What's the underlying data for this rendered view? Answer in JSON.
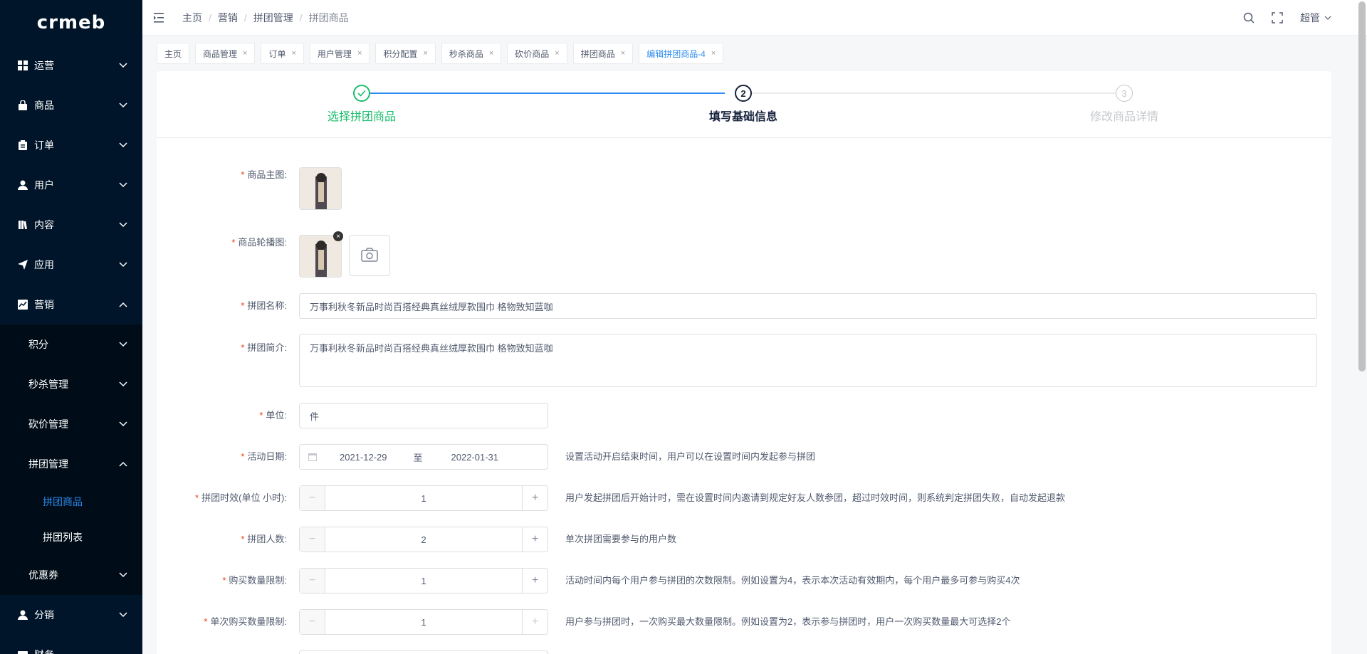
{
  "app": {
    "logo": "crmeb"
  },
  "sidebar": {
    "items": [
      {
        "label": "运营",
        "icon": "grid-icon"
      },
      {
        "label": "商品",
        "icon": "bag-icon"
      },
      {
        "label": "订单",
        "icon": "clipboard-icon"
      },
      {
        "label": "用户",
        "icon": "user-icon"
      },
      {
        "label": "内容",
        "icon": "book-icon"
      },
      {
        "label": "应用",
        "icon": "send-icon"
      },
      {
        "label": "营销",
        "icon": "chart-icon"
      }
    ],
    "marketing_sub": [
      {
        "label": "积分"
      },
      {
        "label": "秒杀管理"
      },
      {
        "label": "砍价管理"
      },
      {
        "label": "拼团管理"
      }
    ],
    "group_sub": [
      {
        "label": "拼团商品"
      },
      {
        "label": "拼团列表"
      }
    ],
    "coupon": "优惠券",
    "distribution": "分销",
    "finance": "财务"
  },
  "header": {
    "breadcrumb": [
      "主页",
      "营销",
      "拼团管理",
      "拼团商品"
    ],
    "user": "超管"
  },
  "tags": [
    {
      "label": "主页",
      "closable": false
    },
    {
      "label": "商品管理",
      "closable": true
    },
    {
      "label": "订单",
      "closable": true
    },
    {
      "label": "用户管理",
      "closable": true
    },
    {
      "label": "积分配置",
      "closable": true
    },
    {
      "label": "秒杀商品",
      "closable": true
    },
    {
      "label": "砍价商品",
      "closable": true
    },
    {
      "label": "拼团商品",
      "closable": true
    },
    {
      "label": "编辑拼团商品-4",
      "closable": true
    }
  ],
  "steps": [
    {
      "title": "选择拼团商品",
      "number": "",
      "status": "done"
    },
    {
      "title": "填写基础信息",
      "number": "2",
      "status": "current"
    },
    {
      "title": "修改商品详情",
      "number": "3",
      "status": "wait"
    }
  ],
  "form": {
    "main_image_label": "商品主图:",
    "carousel_label": "商品轮播图:",
    "name_label": "拼团名称:",
    "name_value": "万事利秋冬新品时尚百搭经典真丝绒厚款围巾 格物致知蓝咖",
    "intro_label": "拼团简介:",
    "intro_value": "万事利秋冬新品时尚百搭经典真丝绒厚款围巾 格物致知蓝咖",
    "unit_label": "单位:",
    "unit_value": "件",
    "date_label": "活动日期:",
    "date_start": "2021-12-29",
    "date_sep": "至",
    "date_end": "2022-01-31",
    "date_tip": "设置活动开启结束时间，用户可以在设置时间内发起参与拼团",
    "effective_label": "拼团时效(单位 小时):",
    "effective_value": "1",
    "effective_tip": "用户发起拼团后开始计时，需在设置时间内邀请到规定好友人数参团，超过时效时间，则系统判定拼团失败，自动发起退款",
    "people_label": "拼团人数:",
    "people_value": "2",
    "people_tip": "单次拼团需要参与的用户数",
    "buy_limit_label": "购买数量限制:",
    "buy_limit_value": "1",
    "buy_limit_tip": "活动时间内每个用户参与拼团的次数限制。例如设置为4，表示本次活动有效期内，每个用户最多可参与购买4次",
    "single_limit_label": "单次购买数量限制:",
    "single_limit_value": "1",
    "single_limit_tip": "用户参与拼团时，一次购买最大数量限制。例如设置为2，表示参与拼团时，用户一次购买数量最大可选择2个"
  },
  "colors": {
    "sidebar_bg": "#001529",
    "accent": "#2d8cf0",
    "success": "#19be6b",
    "required": "#ed4014"
  }
}
